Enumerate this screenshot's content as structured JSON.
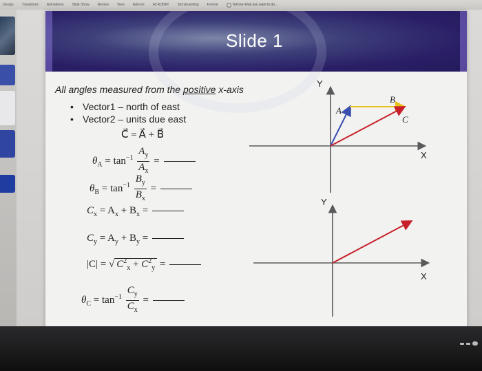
{
  "ribbon": {
    "tabs": [
      "Design",
      "Transitions",
      "Animations",
      "Slide Show",
      "Review",
      "View",
      "Add-ins",
      "ACROBAT",
      "Storyboarding",
      "Format"
    ],
    "tell_me": "Tell me what you want to do..."
  },
  "slide": {
    "title": "Slide 1",
    "intro_before": "All angles measured from the ",
    "intro_underline": "positive",
    "intro_after": " x-axis",
    "bullets": [
      "Vector1 – north of east",
      "Vector2 – units due east"
    ],
    "equations": {
      "sum": "C⃗ = A⃗ + B⃗",
      "thetaA": {
        "lhs": "θ",
        "lhs_sub": "A",
        "fn": "tan",
        "exp": "−1",
        "num": "A",
        "num_sub": "y",
        "den": "A",
        "den_sub": "x"
      },
      "thetaB": {
        "lhs": "θ",
        "lhs_sub": "B",
        "fn": "tan",
        "exp": "−1",
        "num": "B",
        "num_sub": "y",
        "den": "B",
        "den_sub": "x"
      },
      "cx": {
        "text": "C",
        "sub": "x",
        "rhs": "= A",
        "rhs_sub1": "x",
        "plus": " + B",
        "rhs_sub2": "x"
      },
      "cy": {
        "text": "C",
        "sub": "y",
        "rhs": "= A",
        "rhs_sub1": "y",
        "plus": " + B",
        "rhs_sub2": "y"
      },
      "mag": {
        "lhs": "|C| =",
        "c1": "C",
        "c1_sub": "x",
        "c1_sup": "2",
        "plus": " + ",
        "c2": "C",
        "c2_sub": "y",
        "c2_sup": "2"
      },
      "thetaC": {
        "lhs": "θ",
        "lhs_sub": "C",
        "fn": "tan",
        "exp": "−1",
        "num": "C",
        "num_sub": "y",
        "den": "C",
        "den_sub": "x"
      },
      "equals": "="
    },
    "diagram_top": {
      "y_label": "Y",
      "x_label": "X",
      "a_label": "A⃗",
      "b_label": "B⃗",
      "c_label": "C⃗"
    },
    "diagram_bottom": {
      "y_label": "Y",
      "x_label": "X"
    }
  },
  "colors": {
    "vector_a": "#3a4fb0",
    "vector_b": "#e8c21a",
    "vector_c": "#c8202a",
    "axis": "#5a5a5a"
  }
}
